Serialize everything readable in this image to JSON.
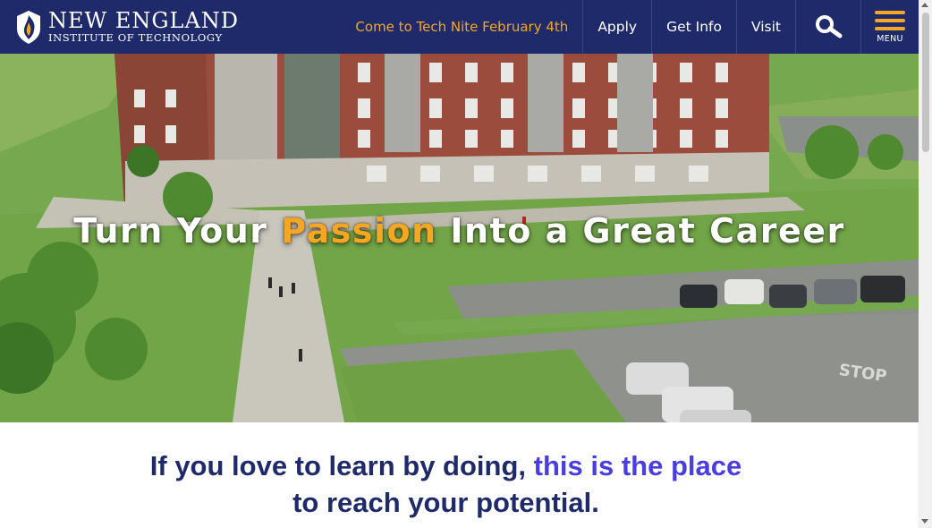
{
  "header": {
    "brand_line1": "NEW ENGLAND",
    "brand_line2": "INSTITUTE OF TECHNOLOGY",
    "promo_link": "Come to Tech Nite February 4th",
    "nav": [
      {
        "label": "Apply"
      },
      {
        "label": "Get Info"
      },
      {
        "label": "Visit"
      }
    ],
    "menu_label": "MENU",
    "search_icon": "search-icon",
    "menu_icon": "hamburger-menu-icon"
  },
  "hero": {
    "headline_before": "Turn Your ",
    "headline_accent": "Passion",
    "headline_after": " Into a Great Career",
    "road_marking": "STOP"
  },
  "tagline": {
    "part1": "If you love to learn by doing, ",
    "part2": "this is the place",
    "line2": "to reach your potential."
  },
  "colors": {
    "navy": "#1f2a6b",
    "accent_orange": "#f5a623",
    "accent_purple": "#4a3ee0"
  }
}
